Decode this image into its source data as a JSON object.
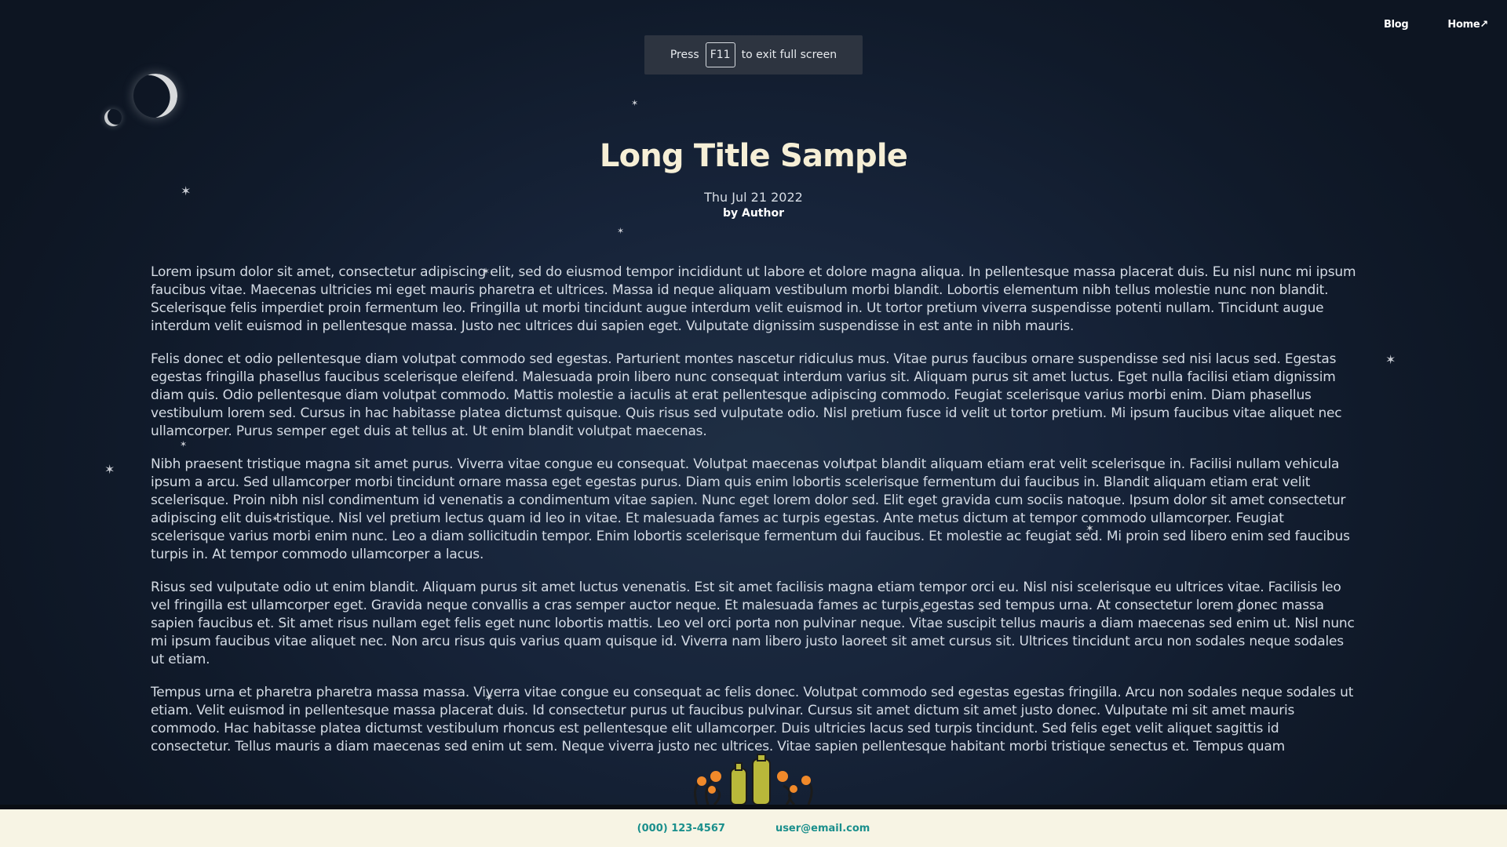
{
  "nav": {
    "blog_label": "Blog",
    "home_label": "Home↗"
  },
  "fullscreen_notice": {
    "prefix": "Press",
    "key": "F11",
    "suffix": "to exit full screen"
  },
  "article": {
    "title": "Long Title Sample",
    "date": "Thu Jul 21 2022",
    "author": "by Author",
    "paragraphs": [
      "Lorem ipsum dolor sit amet, consectetur adipiscing elit, sed do eiusmod tempor incididunt ut labore et dolore magna aliqua. In pellentesque massa placerat duis. Eu nisl nunc mi ipsum faucibus vitae. Maecenas ultricies mi eget mauris pharetra et ultrices. Massa id neque aliquam vestibulum morbi blandit. Lobortis elementum nibh tellus molestie nunc non blandit. Scelerisque felis imperdiet proin fermentum leo. Fringilla ut morbi tincidunt augue interdum velit euismod in. Ut tortor pretium viverra suspendisse potenti nullam. Tincidunt augue interdum velit euismod in pellentesque massa. Justo nec ultrices dui sapien eget. Vulputate dignissim suspendisse in est ante in nibh mauris.",
      "Felis donec et odio pellentesque diam volutpat commodo sed egestas. Parturient montes nascetur ridiculus mus. Vitae purus faucibus ornare suspendisse sed nisi lacus sed. Egestas egestas fringilla phasellus faucibus scelerisque eleifend. Malesuada proin libero nunc consequat interdum varius sit. Aliquam purus sit amet luctus. Eget nulla facilisi etiam dignissim diam quis. Odio pellentesque diam volutpat commodo. Mattis molestie a iaculis at erat pellentesque adipiscing commodo. Feugiat scelerisque varius morbi enim. Diam phasellus vestibulum lorem sed. Cursus in hac habitasse platea dictumst quisque. Quis risus sed vulputate odio. Nisl pretium fusce id velit ut tortor pretium. Mi ipsum faucibus vitae aliquet nec ullamcorper. Purus semper eget duis at tellus at. Ut enim blandit volutpat maecenas.",
      "Nibh praesent tristique magna sit amet purus. Viverra vitae congue eu consequat. Volutpat maecenas volutpat blandit aliquam etiam erat velit scelerisque in. Facilisi nullam vehicula ipsum a arcu. Sed ullamcorper morbi tincidunt ornare massa eget egestas purus. Diam quis enim lobortis scelerisque fermentum dui faucibus in. Blandit aliquam etiam erat velit scelerisque. Proin nibh nisl condimentum id venenatis a condimentum vitae sapien. Nunc eget lorem dolor sed. Elit eget gravida cum sociis natoque. Ipsum dolor sit amet consectetur adipiscing elit duis tristique. Nisl vel pretium lectus quam id leo in vitae. Et malesuada fames ac turpis egestas. Ante metus dictum at tempor commodo ullamcorper. Feugiat scelerisque varius morbi enim nunc. Leo a diam sollicitudin tempor. Enim lobortis scelerisque fermentum dui faucibus. Et molestie ac feugiat sed. Mi proin sed libero enim sed faucibus turpis in. At tempor commodo ullamcorper a lacus.",
      "Risus sed vulputate odio ut enim blandit. Aliquam purus sit amet luctus venenatis. Est sit amet facilisis magna etiam tempor orci eu. Nisl nisi scelerisque eu ultrices vitae. Facilisis leo vel fringilla est ullamcorper eget. Gravida neque convallis a cras semper auctor neque. Et malesuada fames ac turpis egestas sed tempus urna. At consectetur lorem donec massa sapien faucibus et. Sit amet risus nullam eget felis eget nunc lobortis mattis. Leo vel orci porta non pulvinar neque. Vitae suscipit tellus mauris a diam maecenas sed enim ut. Nisl nunc mi ipsum faucibus vitae aliquet nec. Non arcu risus quis varius quam quisque id. Viverra nam libero justo laoreet sit amet cursus sit. Ultrices tincidunt arcu non sodales neque sodales ut etiam.",
      "Tempus urna et pharetra pharetra massa massa. Viverra vitae congue eu consequat ac felis donec. Volutpat commodo sed egestas egestas fringilla. Arcu non sodales neque sodales ut etiam. Velit euismod in pellentesque massa placerat duis. Id consectetur purus ut faucibus pulvinar. Cursus sit amet dictum sit amet justo donec. Vulputate mi sit amet mauris commodo. Hac habitasse platea dictumst vestibulum rhoncus est pellentesque elit ullamcorper. Duis ultricies lacus sed turpis tincidunt. Sed felis eget velit aliquet sagittis id consectetur. Tellus mauris a diam maecenas sed enim ut sem. Neque viverra justo nec ultrices. Vitae sapien pellentesque habitant morbi tristique senectus et. Tempus quam"
    ]
  },
  "footer": {
    "phone": "(000) 123-4567",
    "email": "user@email.com"
  },
  "colors": {
    "background": "#17243a",
    "title": "#f6efd6",
    "footer_bg": "#f7f4e4",
    "footer_link": "#1a8f8c",
    "plant_orange": "#f0892a",
    "plant_green": "#b9b83a"
  },
  "icons": [
    "moon-icon",
    "star-icon",
    "plant-decoration"
  ]
}
